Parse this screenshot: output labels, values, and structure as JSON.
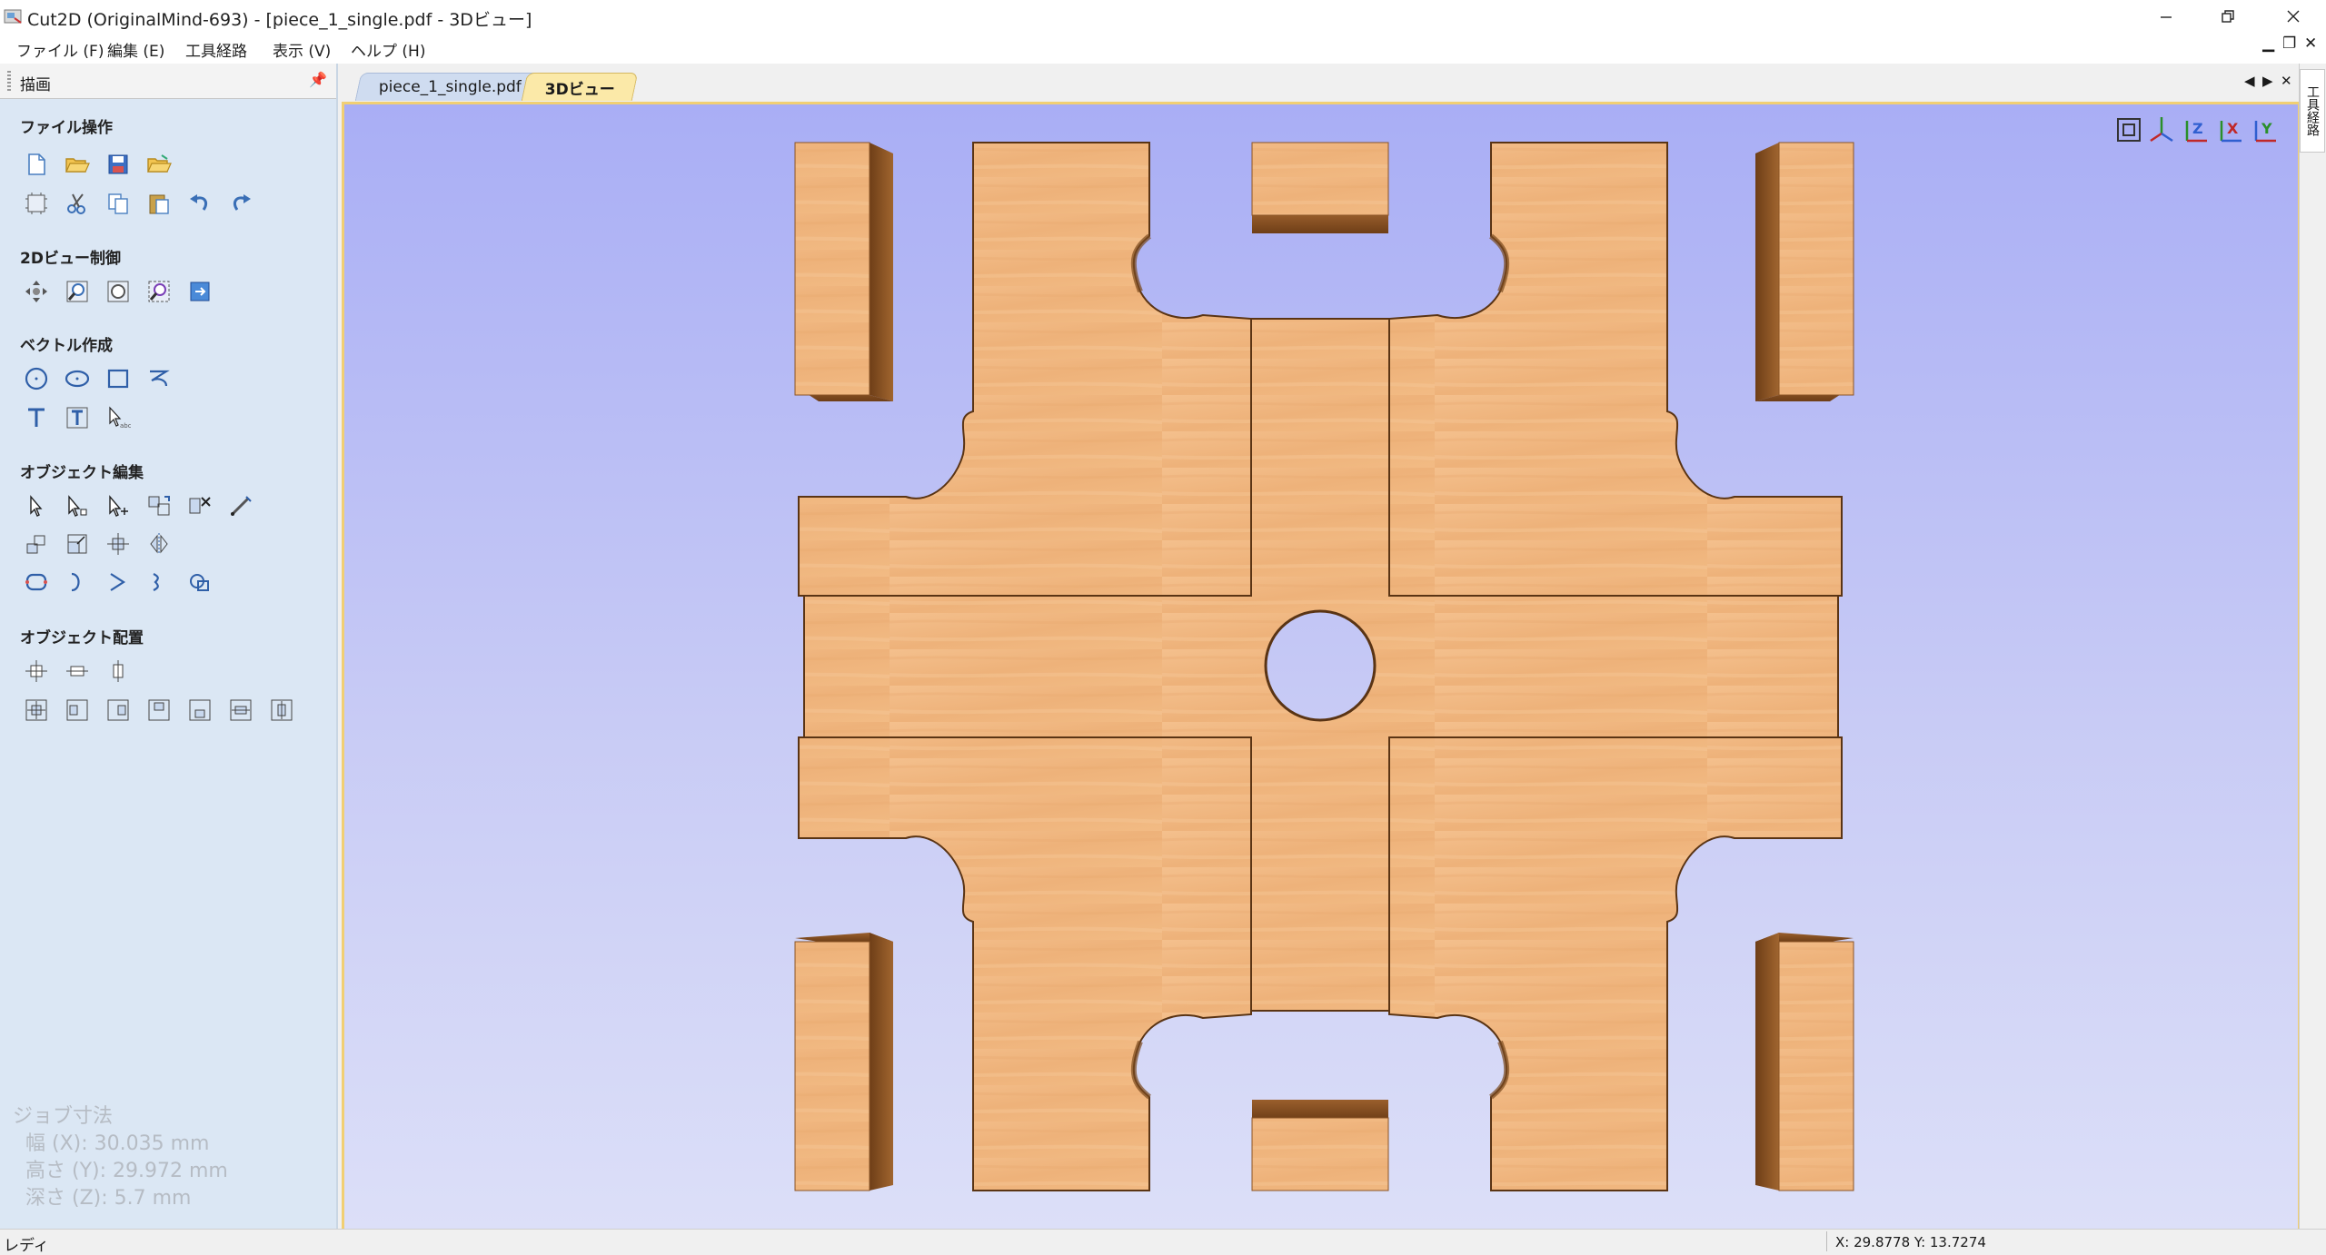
{
  "window": {
    "title": "Cut2D (OriginalMind-693) - [piece_1_single.pdf - 3Dビュー]",
    "minimize_icon": "minimize-icon",
    "maximize_icon": "restore-icon",
    "close_icon": "close-icon"
  },
  "menu": {
    "items": [
      "ファイル (F)",
      "編集 (E)",
      "工具経路",
      "表示 (V)",
      "ヘルプ (H)"
    ]
  },
  "panel": {
    "title": "描画",
    "sections": [
      {
        "title": "ファイル操作"
      },
      {
        "title": "2Dビュー制御"
      },
      {
        "title": "ベクトル作成"
      },
      {
        "title": "オブジェクト編集"
      },
      {
        "title": "オブジェクト配置"
      }
    ]
  },
  "job": {
    "heading": "ジョブ寸法",
    "width": "幅  (X): 30.035 mm",
    "height": "高さ (Y): 29.972 mm",
    "depth": "深さ (Z): 5.7 mm"
  },
  "tabs": [
    {
      "label": "piece_1_single.pdf",
      "active": false
    },
    {
      "label": "3Dビュー",
      "active": true
    }
  ],
  "right_tab": {
    "label": "工具経路"
  },
  "status": {
    "text": "レディ",
    "coords": "X: 29.8778 Y: 13.7274"
  },
  "view_toolbar": {
    "icons": [
      "fit-view-icon",
      "iso-view-icon",
      "top-view-z-icon",
      "front-view-x-icon",
      "side-view-y-icon"
    ],
    "labels": [
      "",
      "",
      "Z",
      "X",
      "Y"
    ]
  },
  "colors": {
    "wood": "#f0b57d",
    "wood_side": "#8a5426",
    "view_top": "#a9aef5",
    "view_bottom": "#dcdff8",
    "active_tab": "#fbe9a8",
    "panel_bg": "#dbe7f4"
  }
}
